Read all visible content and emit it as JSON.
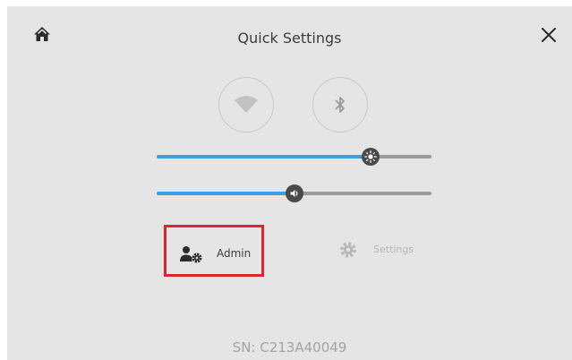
{
  "header": {
    "title": "Quick Settings",
    "home_icon": "home-icon",
    "close_icon": "close-icon"
  },
  "toggles": {
    "wifi_icon": "wifi-icon",
    "bluetooth_icon": "bluetooth-icon"
  },
  "sliders": {
    "brightness_level": 0.78,
    "volume_level": 0.5
  },
  "actions": {
    "admin_label": "Admin",
    "settings_label": "Settings"
  },
  "footer": {
    "serial": "SN: C213A40049"
  },
  "colors": {
    "accent": "#3b9de3",
    "highlight": "#e0242b"
  }
}
